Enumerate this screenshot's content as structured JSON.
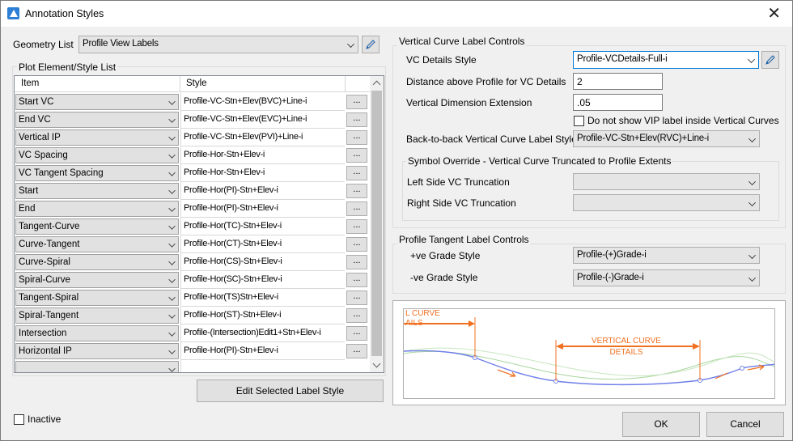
{
  "window": {
    "title": "Annotation Styles",
    "close_glyph": "✕"
  },
  "geometry_list": {
    "label": "Geometry List",
    "value": "Profile View Labels"
  },
  "plot_element": {
    "group_title": "Plot Element/Style List",
    "col_item": "Item",
    "col_style": "Style",
    "browse_label": "...",
    "rows": [
      {
        "item": "Start VC",
        "style": "Profile-VC-Stn+Elev(BVC)+Line-i"
      },
      {
        "item": "End VC",
        "style": "Profile-VC-Stn+Elev(EVC)+Line-i"
      },
      {
        "item": "Vertical IP",
        "style": "Profile-VC-Stn+Elev(PVI)+Line-i"
      },
      {
        "item": "VC Spacing",
        "style": "Profile-Hor-Stn+Elev-i"
      },
      {
        "item": "VC Tangent Spacing",
        "style": "Profile-Hor-Stn+Elev-i"
      },
      {
        "item": "Start",
        "style": "Profile-Hor(PI)-Stn+Elev-i"
      },
      {
        "item": "End",
        "style": "Profile-Hor(PI)-Stn+Elev-i"
      },
      {
        "item": "Tangent-Curve",
        "style": "Profile-Hor(TC)-Stn+Elev-i"
      },
      {
        "item": "Curve-Tangent",
        "style": "Profile-Hor(CT)-Stn+Elev-i"
      },
      {
        "item": "Curve-Spiral",
        "style": "Profile-Hor(CS)-Stn+Elev-i"
      },
      {
        "item": "Spiral-Curve",
        "style": "Profile-Hor(SC)-Stn+Elev-i"
      },
      {
        "item": "Tangent-Spiral",
        "style": "Profile-Hor(TS)Stn+Elev-i"
      },
      {
        "item": "Spiral-Tangent",
        "style": "Profile-Hor(ST)-Stn+Elev-i"
      },
      {
        "item": "Intersection",
        "style": "Profile-(Intersection)Edit1+Stn+Elev-i"
      },
      {
        "item": "Horizontal IP",
        "style": "Profile-Hor(PI)-Stn+Elev-i"
      },
      {
        "item": "",
        "style": ""
      }
    ]
  },
  "edit_selected_button": "Edit Selected Label Style",
  "inactive_label": "Inactive",
  "vc_label_controls": {
    "group_title": "Vertical Curve Label Controls",
    "vc_details_style_label": "VC Details Style",
    "vc_details_style_value": "Profile-VCDetails-Full-i",
    "distance_label": "Distance above Profile for VC Details",
    "distance_value": "2",
    "vert_dim_label": "Vertical Dimension Extension",
    "vert_dim_value": ".05",
    "no_vip_label": "Do not show VIP label inside Vertical Curves",
    "b2b_label": "Back-to-back Vertical Curve Label Style",
    "b2b_value": "Profile-VC-Stn+Elev(RVC)+Line-i",
    "symbol_override_title": "Symbol Override - Vertical Curve Truncated to Profile Extents",
    "left_trunc_label": "Left Side VC Truncation",
    "left_trunc_value": "",
    "right_trunc_label": "Right Side VC Truncation",
    "right_trunc_value": ""
  },
  "tangent_controls": {
    "group_title": "Profile Tangent Label Controls",
    "pos_label": "+ve Grade Style",
    "pos_value": "Profile-(+)Grade-i",
    "neg_label": "-ve Grade Style",
    "neg_value": "Profile-(-)Grade-i"
  },
  "preview": {
    "text_left_1": "L CURVE",
    "text_left_2": "AILS",
    "text_center_1": "VERTICAL CURVE",
    "text_center_2": "DETAILS",
    "accent": "#f07020",
    "profile_color": "#6f7fe8",
    "ground_color": "#a8d6a0"
  },
  "buttons": {
    "ok": "OK",
    "cancel": "Cancel"
  }
}
